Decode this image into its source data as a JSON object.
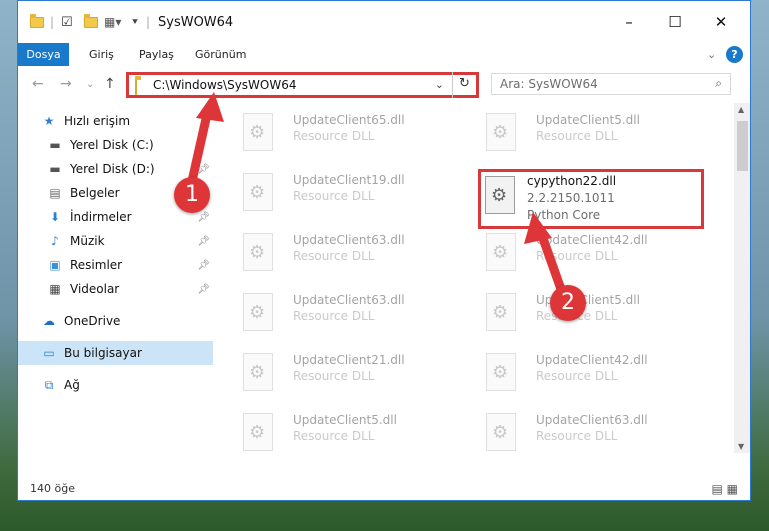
{
  "window": {
    "title": "SysWOW64",
    "controls": {
      "minimize": "–",
      "maximize": "☐",
      "close": "✕"
    }
  },
  "menubar": {
    "items": [
      "Dosya",
      "Giriş",
      "Paylaş",
      "Görünüm"
    ],
    "expand_icon": "chevron-down-icon",
    "help_icon": "help-icon"
  },
  "address": {
    "path": "C:\\Windows\\SysWOW64",
    "search_placeholder": "Ara: SysWOW64"
  },
  "sidebar": {
    "items": [
      {
        "label": "Hızlı erişim",
        "icon": "star-icon",
        "pinned": false,
        "selected": false
      },
      {
        "label": "Yerel Disk (C:)",
        "icon": "drive-icon",
        "pinned": false,
        "selected": false
      },
      {
        "label": "Yerel Disk (D:)",
        "icon": "drive-icon",
        "pinned": true,
        "selected": false
      },
      {
        "label": "Belgeler",
        "icon": "documents-icon",
        "pinned": true,
        "selected": false
      },
      {
        "label": "İndirmeler",
        "icon": "download-icon",
        "pinned": true,
        "selected": false
      },
      {
        "label": "Müzik",
        "icon": "music-icon",
        "pinned": true,
        "selected": false
      },
      {
        "label": "Resimler",
        "icon": "pictures-icon",
        "pinned": true,
        "selected": false
      },
      {
        "label": "Videolar",
        "icon": "videos-icon",
        "pinned": true,
        "selected": false
      },
      {
        "label": "OneDrive",
        "icon": "cloud-icon",
        "pinned": false,
        "selected": false
      },
      {
        "label": "Bu bilgisayar",
        "icon": "computer-icon",
        "pinned": false,
        "selected": true
      },
      {
        "label": "Ağ",
        "icon": "network-icon",
        "pinned": false,
        "selected": false
      }
    ]
  },
  "files": [
    {
      "name": "UpdateClient65.dll",
      "type": "Resource DLL"
    },
    {
      "name": "UpdateClient5.dll",
      "type": "Resource DLL"
    },
    {
      "name": "UpdateClient19.dll",
      "type": "Resource DLL"
    },
    {
      "name": "UpdateClient63.dll",
      "type": "Resource DLL"
    },
    {
      "name": "UpdateClient42.dll",
      "type": "Resource DLL"
    },
    {
      "name": "UpdateClient63.dll",
      "type": "Resource DLL"
    },
    {
      "name": "UpdateClient5.dll",
      "type": "Resource DLL"
    },
    {
      "name": "UpdateClient21.dll",
      "type": "Resource DLL"
    },
    {
      "name": "UpdateClient42.dll",
      "type": "Resource DLL"
    },
    {
      "name": "UpdateClient5.dll",
      "type": "Resource DLL"
    },
    {
      "name": "UpdateClient63.dll",
      "type": "Resource DLL"
    }
  ],
  "highlighted_file": {
    "name": "cypython22.dll",
    "version": "2.2.2150.1011",
    "description": "Python Core"
  },
  "status": {
    "count": "140 öğe"
  },
  "annotations": {
    "badge1": "1",
    "badge2": "2",
    "color": "#de3539"
  }
}
